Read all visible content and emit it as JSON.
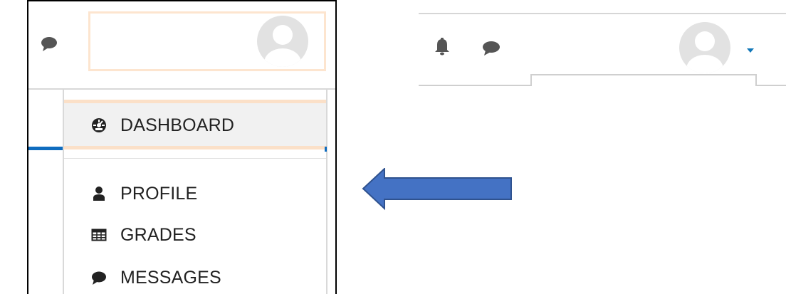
{
  "menu": {
    "items": [
      {
        "label": "DASHBOARD",
        "icon": "dashboard-icon",
        "active": true
      },
      {
        "label": "PROFILE",
        "icon": "user-icon",
        "active": false
      },
      {
        "label": "GRADES",
        "icon": "table-icon",
        "active": false
      },
      {
        "label": "MESSAGES",
        "icon": "comment-icon",
        "active": false
      }
    ]
  },
  "icons": {
    "left_header": [
      "comment-icon",
      "avatar"
    ],
    "right_nav": [
      "bell-icon",
      "comment-icon",
      "avatar",
      "caret-down-icon"
    ],
    "annotation": "left-arrow"
  },
  "colors": {
    "accent_blue": "#0f6cbf",
    "arrow_fill": "#4472c4",
    "arrow_stroke": "#2f528f",
    "highlight_border": "#fbe0c8",
    "icon_gray": "#555555",
    "avatar_gray": "#e2e2e2",
    "caret_teal": "#1177b8"
  }
}
